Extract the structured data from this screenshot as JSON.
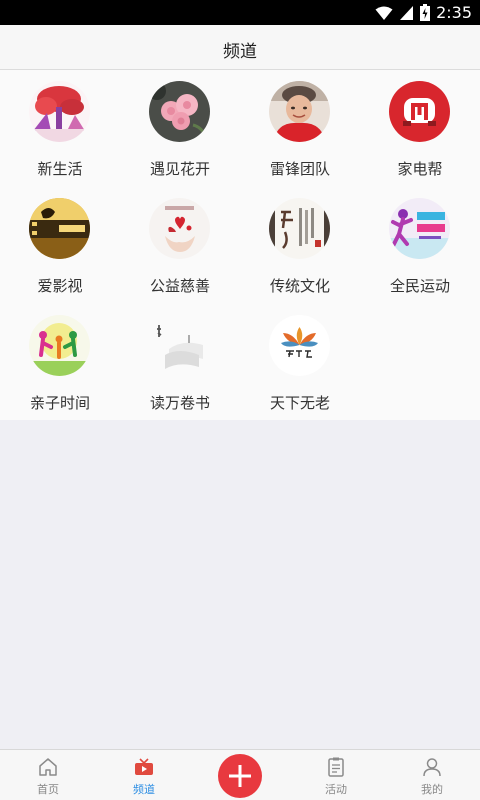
{
  "status_bar": {
    "time": "2:35"
  },
  "header": {
    "title": "频道"
  },
  "channels": [
    {
      "label": "新生活",
      "icon": "red-tree-icon"
    },
    {
      "label": "遇见花开",
      "icon": "roses-icon"
    },
    {
      "label": "雷锋团队",
      "icon": "elder-portrait-icon"
    },
    {
      "label": "家电帮",
      "icon": "appliance-logo-icon"
    },
    {
      "label": "爱影视",
      "icon": "film-icon"
    },
    {
      "label": "公益慈善",
      "icon": "charity-hands-icon"
    },
    {
      "label": "传统文化",
      "icon": "calligraphy-icon"
    },
    {
      "label": "全民运动",
      "icon": "runner-icon"
    },
    {
      "label": "亲子时间",
      "icon": "family-icon"
    },
    {
      "label": "读万卷书",
      "icon": "book-icon"
    },
    {
      "label": "天下无老",
      "icon": "lotus-logo-icon"
    }
  ],
  "bottom_nav": {
    "tabs": [
      {
        "label": "首页",
        "icon": "home-icon"
      },
      {
        "label": "频道",
        "icon": "tv-icon",
        "active": true
      },
      {
        "label": "活动",
        "icon": "clipboard-icon"
      },
      {
        "label": "我的",
        "icon": "user-icon"
      }
    ],
    "add_icon": "plus-icon"
  },
  "colors": {
    "accent": "#2d8ee3",
    "add_button": "#e8393f"
  }
}
